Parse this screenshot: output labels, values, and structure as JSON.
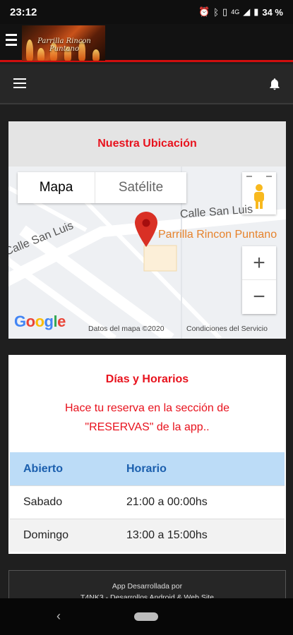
{
  "status_bar": {
    "time": "23:12",
    "battery": "34 %",
    "icons": [
      "alarm-icon",
      "bluetooth-icon",
      "vibrate-icon",
      "4g-icon",
      "wifi-icon",
      "signal-icon",
      "battery-icon"
    ],
    "network": "4G"
  },
  "header": {
    "logo_text": "Parrilla Rincon Puntano",
    "menu_icon": "hamburger-icon",
    "accent_color": "#d10e0e"
  },
  "subheader": {
    "menu_icon": "hamburger-icon",
    "bell_icon": "bell-icon"
  },
  "location_card": {
    "title": "Nuestra Ubicación",
    "map": {
      "tabs": [
        "Mapa",
        "Satélite"
      ],
      "active_tab": "Mapa",
      "street_1": "Calle San Luis",
      "street_2": "Calle San Luis",
      "place_label": "Parrilla Rincon Puntano",
      "google_logo": "Google",
      "attribution": "Datos del mapa ©2020",
      "terms": "Condiciones del Servicio",
      "zoom_in": "+",
      "zoom_out": "−"
    }
  },
  "hours_card": {
    "title": "Días y Horarios",
    "notice_line1": "Hace tu reserva en la sección de",
    "notice_line2": "\"RESERVAS\" de la app..",
    "columns": [
      "Abierto",
      "Horario"
    ],
    "rows": [
      {
        "day": "Sabado",
        "hours": "21:00 a 00:00hs"
      },
      {
        "day": "Domingo",
        "hours": "13:00 a 15:00hs"
      }
    ]
  },
  "footer": {
    "line1": "App Desarrollada por",
    "line2": "T4NK3 - Desarrollos Android & Web Site"
  },
  "colors": {
    "title_red": "#e8121d",
    "table_header_bg": "#bcdcf7",
    "table_header_text": "#1b5fae"
  }
}
